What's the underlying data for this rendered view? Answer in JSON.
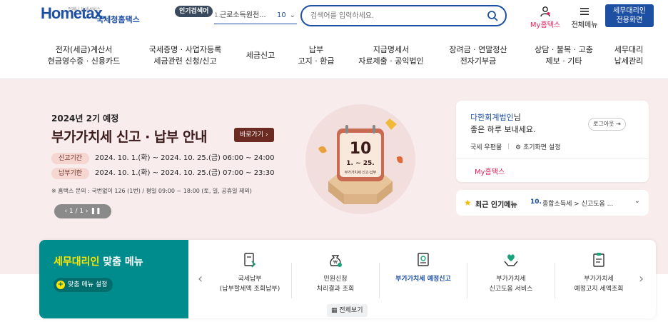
{
  "header": {
    "logo_text": "Hometax.",
    "logo_small": "언제나 납세서비스",
    "logo_name": "국세청홈택스",
    "hot_badge": "인기검색어",
    "hot_rank": "1.",
    "hot_keyword": "근로소득원천...",
    "hot_next": "10",
    "search_placeholder": "검색어를 입력하세요.",
    "myhome_label": "My홈택스",
    "allmenu_label": "전체메뉴",
    "agent_button_line1": "세무대리인",
    "agent_button_line2": "전용화면"
  },
  "gnb": [
    {
      "line1": "전자(세금)계산서",
      "line2": "현금영수증 · 신용카드"
    },
    {
      "line1": "국세증명 · 사업자등록",
      "line2": "세금관련 신청/신고"
    },
    {
      "line1": "세금신고",
      "line2": ""
    },
    {
      "line1": "납부",
      "line2": "고지 · 환급"
    },
    {
      "line1": "지급명세서",
      "line2": "자료제출 · 공익법인"
    },
    {
      "line1": "장려금 · 연말정산",
      "line2": "전자기부금"
    },
    {
      "line1": "상담 · 불복 · 고충",
      "line2": "제보 · 기타"
    },
    {
      "line1": "세무대리",
      "line2": "납세관리"
    }
  ],
  "banner": {
    "subtitle": "2024년 2기 예정",
    "title": "부가가치세 신고 · 납부 안내",
    "go_label": "바로가기 ›",
    "rows": [
      {
        "tag": "신고기간",
        "text": "2024. 10. 1.(화) ~ 2024. 10. 25.(금) 06:00 ~ 24:00"
      },
      {
        "tag": "납부기한",
        "text": "2024. 10. 1.(화) ~ 2024. 10. 25.(금) 07:00 ~ 23:30"
      }
    ],
    "note": "※ 홈택스 문의 : 국번없이 126 (1번) / 평일 09:00 ~ 18:00 (토, 일, 공휴일 제외)",
    "pager": "‹  1 / 1  ›   ❚❚",
    "calendar_day": "10",
    "calendar_range": "1. ~ 25.",
    "calendar_caption": "부가가치세 신고·납부"
  },
  "login_card": {
    "user_name": "다한회계법인",
    "user_suffix": "님",
    "greeting": "좋은 하루 보내세요.",
    "logout_label": "로그아웃 ⇥",
    "link1": "국세 우편물",
    "link2": "⚙ 초기화면 설정",
    "myhome_link": "My홈택스"
  },
  "popular_menu": {
    "label": "최근 인기메뉴",
    "rank": "10.",
    "text": "종합소득세 > 신고도움 ..."
  },
  "custom_menu": {
    "title_highlight": "세무대리인",
    "title_rest": " 맞춤 메뉴",
    "setting_label": "맞춤 메뉴 설정",
    "items": [
      {
        "line1": "국세납부",
        "line2": "(납부할세액 조회납부)",
        "icon": "tax-payment-icon"
      },
      {
        "line1": "민원신청",
        "line2": "처리결과 조회",
        "icon": "money-bag-icon"
      },
      {
        "line1": "부가가치세 예정신고",
        "line2": "",
        "icon": "vat-document-icon"
      },
      {
        "line1": "부가가치세",
        "line2": "신고도움 서비스",
        "icon": "heart-hands-icon"
      },
      {
        "line1": "부가가치세",
        "line2": "예정고지 세액조회",
        "icon": "clipboard-icon"
      }
    ],
    "view_all_label": "전체보기"
  },
  "colors": {
    "brand_blue": "#1d4fa3",
    "accent_pink": "#e0245e",
    "banner_bg": "#f8ecec",
    "teal": "#008c8c"
  }
}
